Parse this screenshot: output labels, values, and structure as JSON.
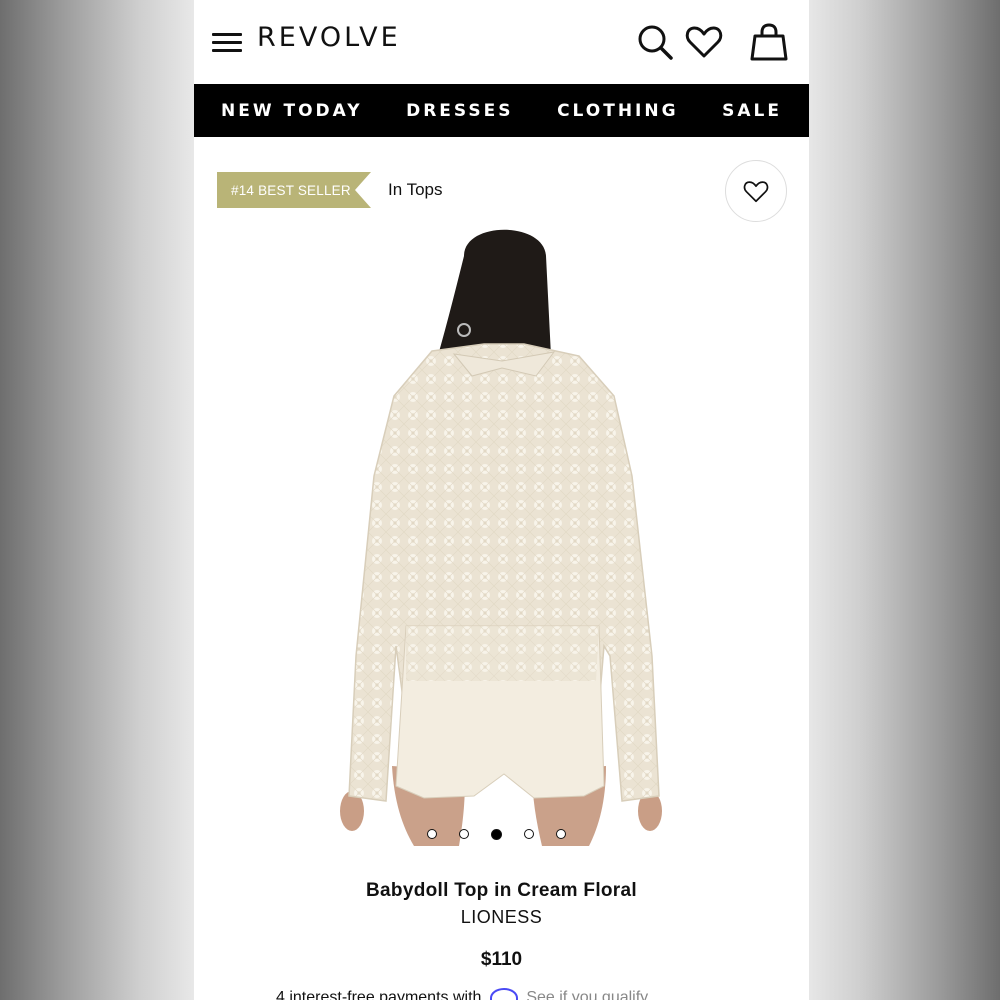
{
  "header": {
    "logo": "REVOLVE",
    "icons": [
      "menu-icon",
      "search-icon",
      "heart-icon",
      "shopping-bag-icon"
    ]
  },
  "nav": {
    "items": [
      "NEW TODAY",
      "DRESSES",
      "CLOTHING",
      "SALE"
    ]
  },
  "badge": {
    "label": "#14 BEST SELLER",
    "color": "#b9b477"
  },
  "category": "In Tops",
  "gallery": {
    "image_count": 5,
    "active_index": 2
  },
  "product": {
    "title": "Babydoll Top in Cream Floral",
    "brand": "LIONESS",
    "price": "$110"
  },
  "payments": {
    "text": "4 interest-free payments with",
    "link": "See if you qualify"
  }
}
